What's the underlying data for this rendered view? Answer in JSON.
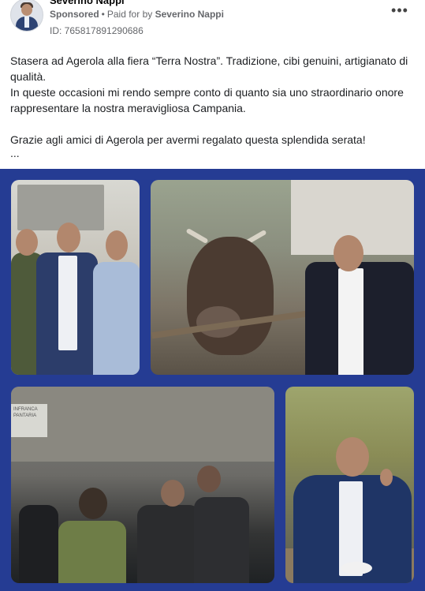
{
  "post": {
    "author": "Severino Nappi",
    "sponsored": "Sponsored",
    "separator": "•",
    "paid_for_prefix": "Paid for by",
    "paid_for_name": "Severino Nappi",
    "ad_id": "ID: 765817891290686",
    "more_icon": "more-horizontal-icon",
    "more_glyph": "•••"
  },
  "body": {
    "line1": "Stasera ad Agerola alla fiera “Terra Nostra”. Tradizione, cibi genuini, artigianato di qualità.",
    "line2": "In queste occasioni mi rendo sempre conto di quanto sia uno straordinario onore rappresentare la nostra meravigliosa Campania.",
    "line3": "Grazie agli amici di Agerola per avermi regalato questa splendida serata!",
    "ellipsis": "..."
  },
  "collage": {
    "background": "#253c93",
    "photo3_sign": "INFRANCA PANTARIA"
  }
}
